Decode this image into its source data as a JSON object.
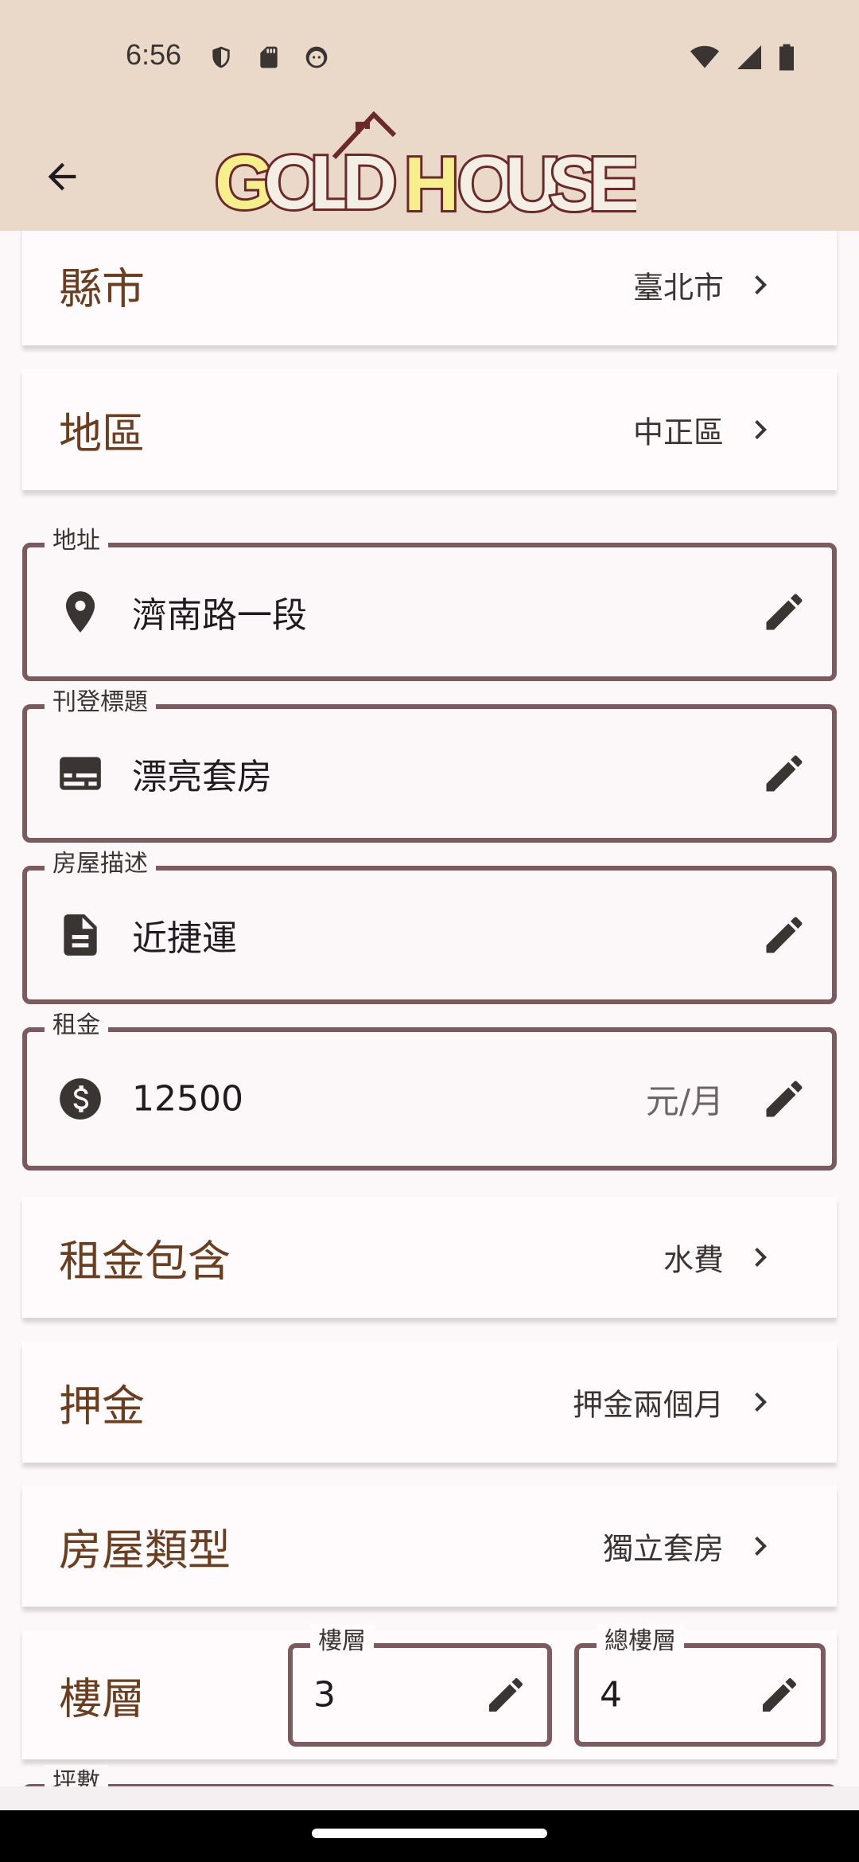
{
  "status_bar": {
    "time": "6:56",
    "left_icons": [
      "shield-icon",
      "sd-card-icon",
      "face-icon"
    ],
    "right_icons": [
      "wifi-icon",
      "signal-icon",
      "battery-icon"
    ]
  },
  "app_bar": {
    "back_icon": "arrow-back-icon",
    "logo_text": "GOLD HOUSE"
  },
  "form": {
    "county": {
      "label": "縣市",
      "value": "臺北市"
    },
    "district": {
      "label": "地區",
      "value": "中正區"
    },
    "address": {
      "label": "地址",
      "value": "濟南路一段",
      "icon": "location-pin-icon"
    },
    "title": {
      "label": "刊登標題",
      "value": "漂亮套房",
      "icon": "subtitles-icon"
    },
    "description": {
      "label": "房屋描述",
      "value": "近捷運",
      "icon": "document-icon"
    },
    "rent": {
      "label": "租金",
      "value": "12500",
      "suffix": "元/月",
      "icon": "dollar-icon"
    },
    "rent_includes": {
      "label": "租金包含",
      "value": "水費"
    },
    "deposit": {
      "label": "押金",
      "value": "押金兩個月"
    },
    "house_type": {
      "label": "房屋類型",
      "value": "獨立套房"
    },
    "floor": {
      "label": "樓層",
      "floor_field": {
        "label": "樓層",
        "value": "3"
      },
      "total_floor_field": {
        "label": "總樓層",
        "value": "4"
      }
    },
    "next_field_label": "坪數"
  },
  "colors": {
    "app_bar": "#EAD8C9",
    "label_brown": "#6A3E20",
    "field_border": "#7B5B5F",
    "logo_yellow": "#F7EE8E",
    "logo_outline": "#6B2A2A"
  }
}
